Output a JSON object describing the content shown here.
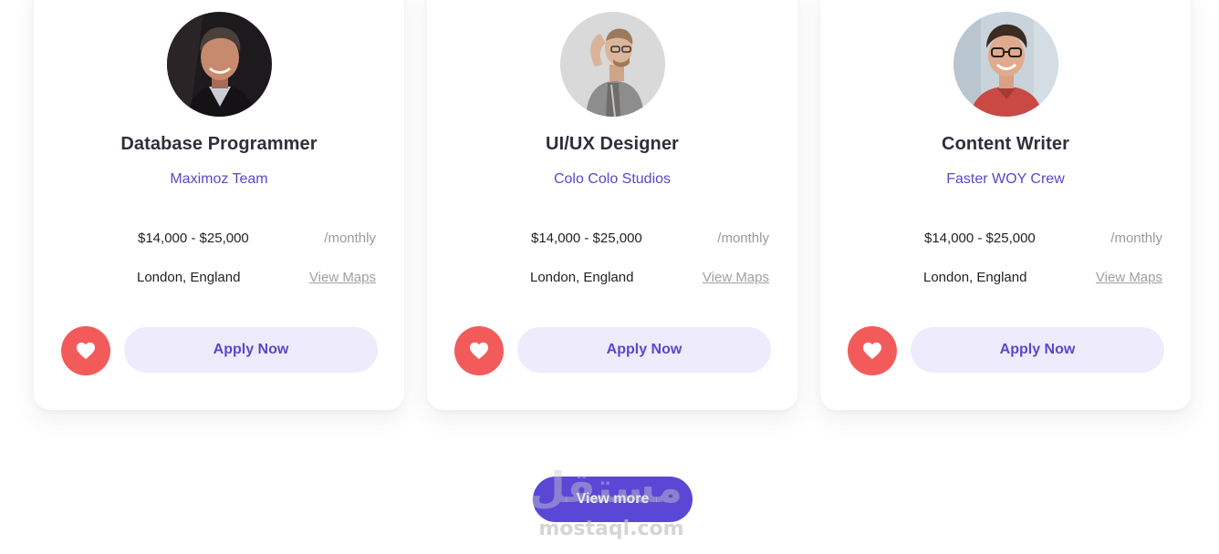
{
  "jobs": [
    {
      "title": "Database Programmer",
      "company": "Maximoz Team",
      "salary": "$14,000 - $25,000",
      "period": "/monthly",
      "location": "London, England",
      "maps_label": "View Maps",
      "apply_label": "Apply Now",
      "avatar_icon": "person-avatar-photo",
      "favorite_icon": "heart-icon"
    },
    {
      "title": "UI/UX Designer",
      "company": "Colo Colo Studios",
      "salary": "$14,000 - $25,000",
      "period": "/monthly",
      "location": "London, England",
      "maps_label": "View Maps",
      "apply_label": "Apply Now",
      "avatar_icon": "person-avatar-photo",
      "favorite_icon": "heart-icon"
    },
    {
      "title": "Content Writer",
      "company": "Faster WOY Crew",
      "salary": "$14,000 - $25,000",
      "period": "/monthly",
      "location": "London, England",
      "maps_label": "View Maps",
      "apply_label": "Apply Now",
      "avatar_icon": "person-avatar-photo",
      "favorite_icon": "heart-icon"
    }
  ],
  "view_more_label": "View more",
  "watermark": {
    "arabic": "مستقل",
    "latin": "mostaql.com"
  },
  "colors": {
    "accent": "#5b47d6",
    "accent_text": "#5b47c9",
    "apply_bg": "#eeebfd",
    "favorite": "#f35b5b",
    "title": "#2f2f3d"
  }
}
